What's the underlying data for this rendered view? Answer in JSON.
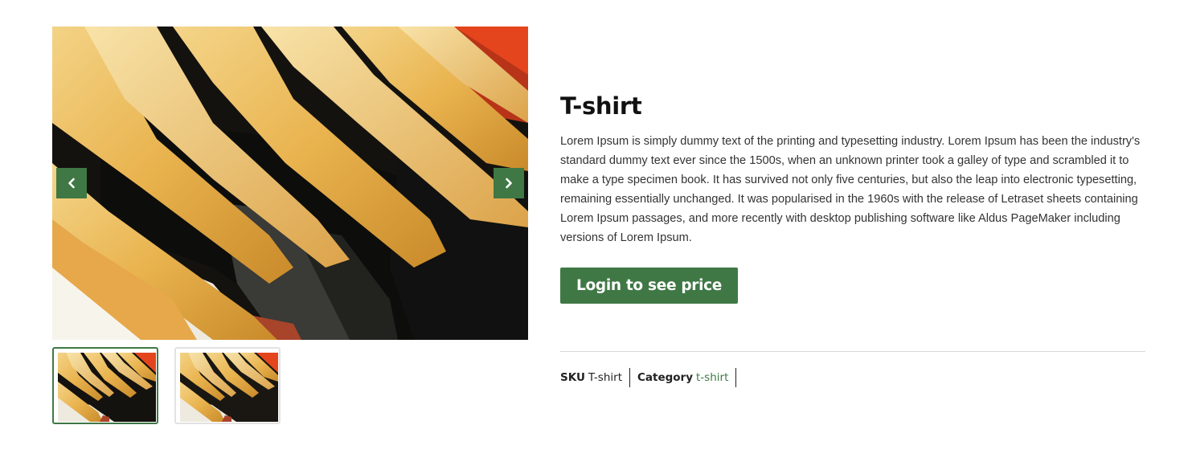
{
  "gallery": {
    "main_image_alt": "clothes-on-hangers-photo",
    "prev_icon": "chevron-left-icon",
    "next_icon": "chevron-right-icon",
    "thumbnails": [
      {
        "active": true
      },
      {
        "active": false
      }
    ],
    "accent_color": "#3f7845"
  },
  "product": {
    "title": "T-shirt",
    "description": "Lorem Ipsum is simply dummy text of the printing and typesetting industry. Lorem Ipsum has been the industry's standard dummy text ever since the 1500s, when an unknown printer took a galley of type and scrambled it to make a type specimen book. It has survived not only five centuries, but also the leap into electronic typesetting, remaining essentially unchanged. It was popularised in the 1960s with the release of Letraset sheets containing Lorem Ipsum passages, and more recently with desktop publishing software like Aldus PageMaker including versions of Lorem Ipsum.",
    "login_button_label": "Login to see price",
    "meta": {
      "sku_label": "SKU",
      "sku_value": "T-shirt",
      "category_label": "Category",
      "category_value": "t-shirt"
    }
  }
}
